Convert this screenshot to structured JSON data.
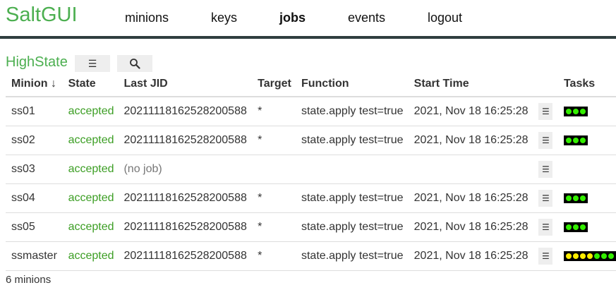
{
  "brand": "SaltGUI",
  "nav": [
    "minions",
    "keys",
    "jobs",
    "events",
    "logout"
  ],
  "active_nav": "jobs",
  "page": {
    "title": "HighState",
    "menu_glyph": "☰",
    "search_icon": "search-icon"
  },
  "table": {
    "headers": [
      "Minion ↓",
      "State",
      "Last JID",
      "Target",
      "Function",
      "Start Time",
      "",
      "Tasks"
    ],
    "rows": [
      {
        "minion": "ss01",
        "state": "accepted",
        "jid": "20211118162528200588",
        "target": "*",
        "function": "state.apply test=true",
        "start": "2021, Nov 18 16:25:28",
        "tasks": [
          "green",
          "green",
          "green"
        ]
      },
      {
        "minion": "ss02",
        "state": "accepted",
        "jid": "20211118162528200588",
        "target": "*",
        "function": "state.apply test=true",
        "start": "2021, Nov 18 16:25:28",
        "tasks": [
          "green",
          "green",
          "green"
        ]
      },
      {
        "minion": "ss03",
        "state": "accepted",
        "jid": "(no job)",
        "target": "",
        "function": "",
        "start": "",
        "tasks": []
      },
      {
        "minion": "ss04",
        "state": "accepted",
        "jid": "20211118162528200588",
        "target": "*",
        "function": "state.apply test=true",
        "start": "2021, Nov 18 16:25:28",
        "tasks": [
          "green",
          "green",
          "green"
        ]
      },
      {
        "minion": "ss05",
        "state": "accepted",
        "jid": "20211118162528200588",
        "target": "*",
        "function": "state.apply test=true",
        "start": "2021, Nov 18 16:25:28",
        "tasks": [
          "green",
          "green",
          "green"
        ]
      },
      {
        "minion": "ssmaster",
        "state": "accepted",
        "jid": "20211118162528200588",
        "target": "*",
        "function": "state.apply test=true",
        "start": "2021, Nov 18 16:25:28",
        "tasks": [
          "yellow",
          "yellow",
          "yellow",
          "yellow",
          "green",
          "green",
          "green"
        ]
      }
    ]
  },
  "footer": "6 minions",
  "colors": {
    "brand": "#4caf50",
    "state": "#3c9e24",
    "task_green": "#33ee00",
    "task_yellow": "#ffee00"
  }
}
